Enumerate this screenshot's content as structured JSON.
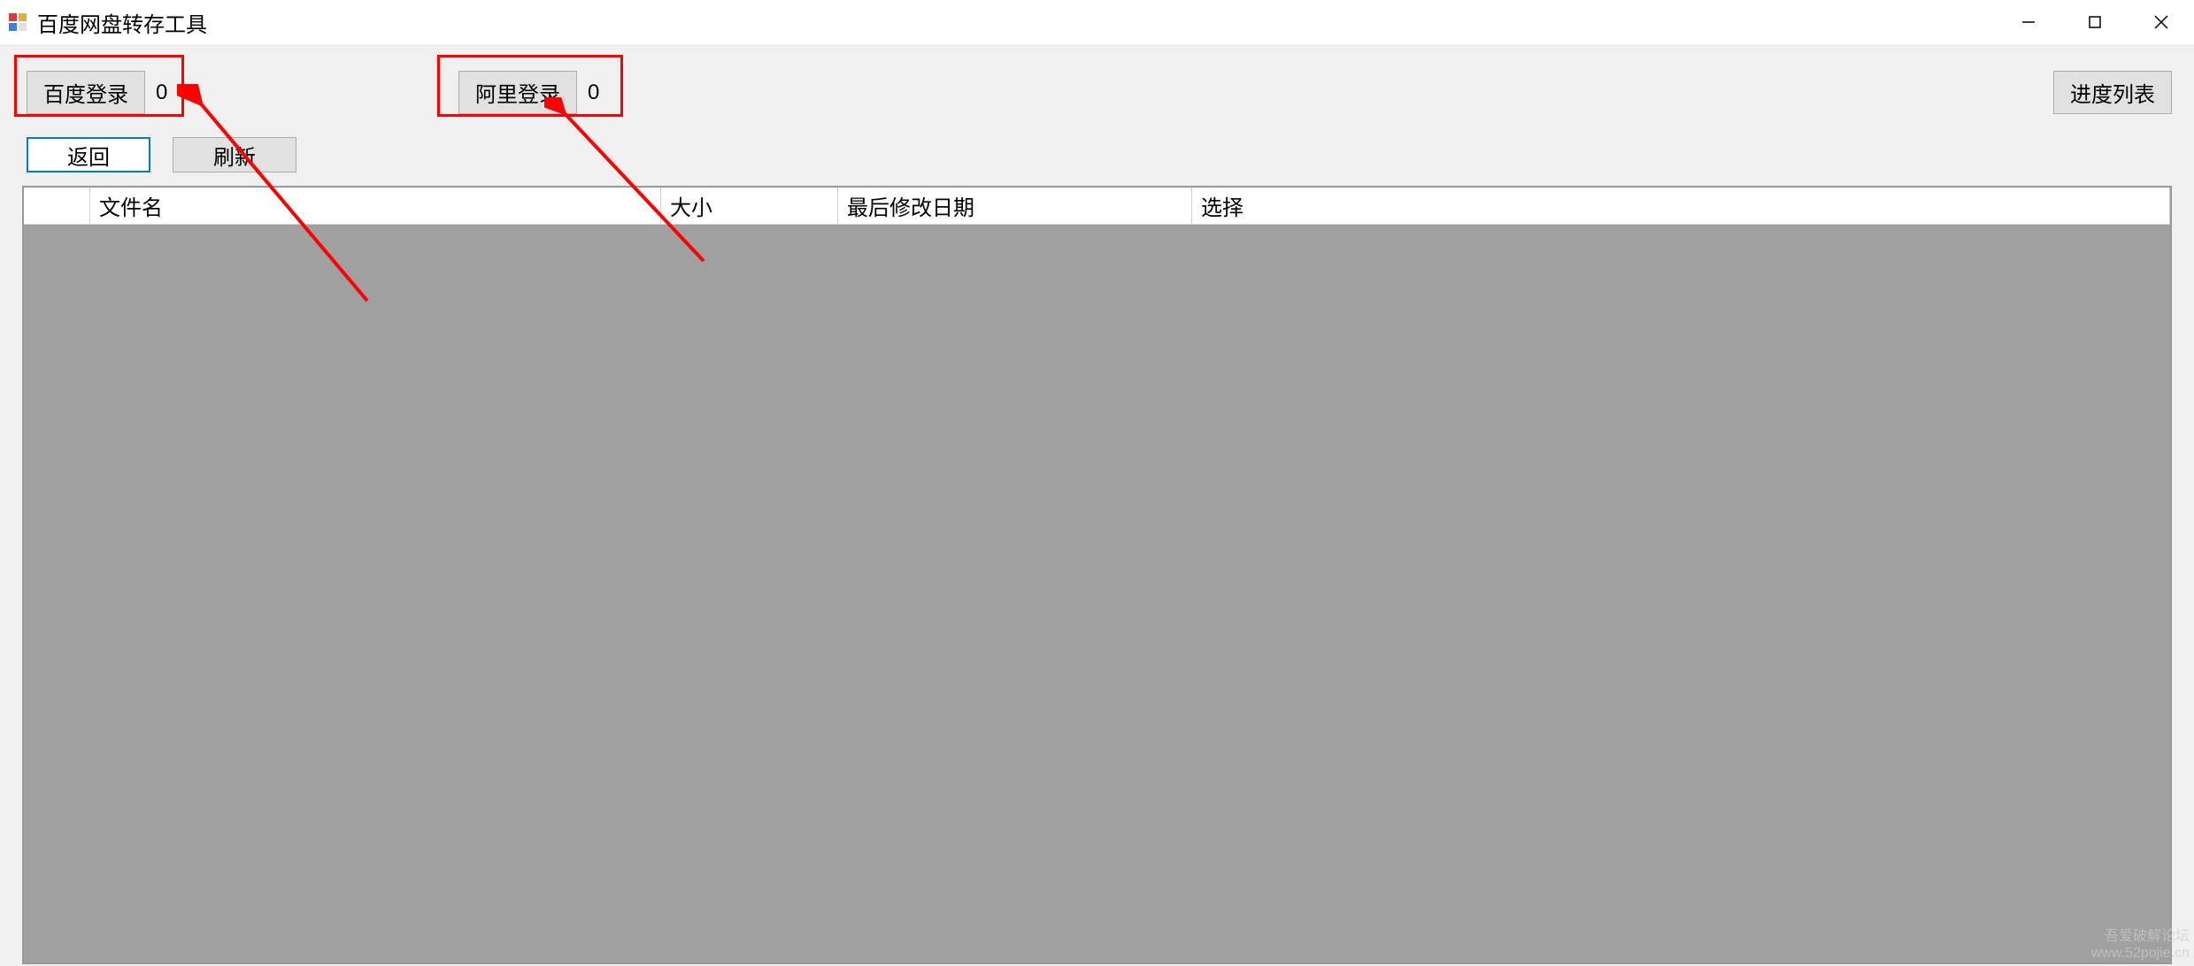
{
  "window": {
    "title": "百度网盘转存工具"
  },
  "toolbar": {
    "baidu_login_label": "百度登录",
    "baidu_count": "0",
    "ali_login_label": "阿里登录",
    "ali_count": "0",
    "progress_list_label": "进度列表"
  },
  "nav": {
    "back_label": "返回",
    "refresh_label": "刷新"
  },
  "table": {
    "columns": {
      "icon": "",
      "filename": "文件名",
      "size": "大小",
      "last_modified": "最后修改日期",
      "select": "选择"
    },
    "rows": []
  },
  "annotations": {
    "highlight_color": "#ff0000"
  },
  "watermark": {
    "line1": "吾爱破解论坛",
    "line2": "www.52pojie.cn"
  }
}
